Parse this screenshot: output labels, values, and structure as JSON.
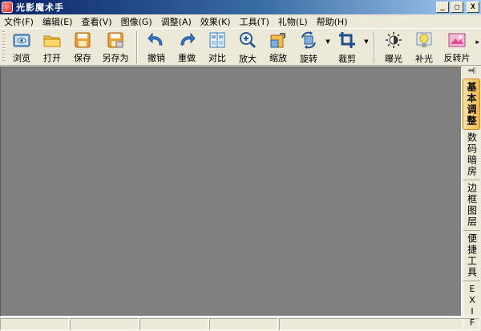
{
  "window": {
    "title": "光影魔术手",
    "min_symbol": "_",
    "max_symbol": "□",
    "close_symbol": "X"
  },
  "menu": [
    {
      "label": "文件(F)"
    },
    {
      "label": "编辑(E)"
    },
    {
      "label": "查看(V)"
    },
    {
      "label": "图像(G)"
    },
    {
      "label": "调整(A)"
    },
    {
      "label": "效果(K)"
    },
    {
      "label": "工具(T)"
    },
    {
      "label": "礼物(L)"
    },
    {
      "label": "帮助(H)"
    }
  ],
  "toolbar": {
    "browse": "浏览",
    "open": "打开",
    "save": "保存",
    "save_as": "另存为",
    "undo": "撤销",
    "redo": "重做",
    "compare": "对比",
    "zoom_in": "放大",
    "resize": "缩放",
    "rotate": "旋转",
    "crop": "裁剪",
    "exposure": "曝光",
    "fill_light": "补光",
    "invert": "反转片",
    "more_symbol": "▸"
  },
  "dock": {
    "collapse_symbol": "◂◂||",
    "tabs": {
      "basic": "基本调整",
      "darkroom": "数码暗房",
      "frame": "边框图层",
      "tools": "便捷工具",
      "exif": "EXIF"
    }
  },
  "colors": {
    "canvas": "#808080",
    "chrome": "#ece9d8",
    "active_tab": "#f5b84a",
    "title_bar": "#0a246a"
  },
  "icons": [
    "browse-icon",
    "open-folder-icon",
    "save-icon",
    "save-as-icon",
    "undo-icon",
    "redo-icon",
    "compare-icon",
    "zoom-in-icon",
    "resize-icon",
    "rotate-icon",
    "crop-icon",
    "exposure-icon",
    "fill-light-icon",
    "invert-film-icon"
  ]
}
